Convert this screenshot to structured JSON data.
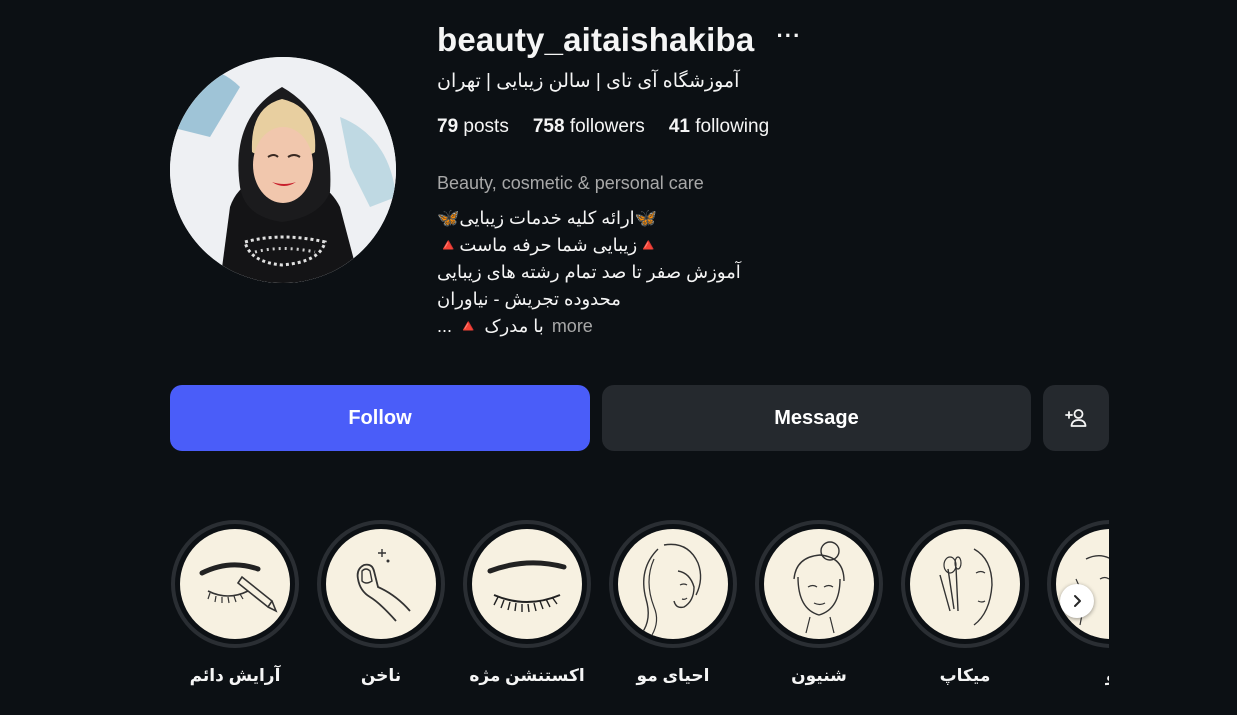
{
  "profile": {
    "username": "beauty_aitaishakiba",
    "options_label": "···",
    "full_name": "آموزشگاه آی تای | سالن زیبایی | تهران",
    "stats": {
      "posts_count": "79",
      "posts_label": "posts",
      "followers_count": "758",
      "followers_label": "followers",
      "following_count": "41",
      "following_label": "following"
    },
    "category": "Beauty, cosmetic & personal care",
    "bio": [
      "🦋ارائه کلیه خدمات زیبایی🦋",
      "🔺زیبایی شما حرفه ماست🔺",
      "آموزش صفر تا صد تمام رشته های زیبایی",
      "محدوده تجریش - نیاوران"
    ],
    "bio_last": "با مدرک 🔺 ...",
    "more_label": "more"
  },
  "actions": {
    "follow_label": "Follow",
    "message_label": "Message",
    "suggest_icon": "add-person-icon"
  },
  "highlights": [
    {
      "label": "آرایش دائم",
      "icon": "eyebrow-pencil-icon"
    },
    {
      "label": "ناخن",
      "icon": "nail-icon"
    },
    {
      "label": "اکستنشن مژه",
      "icon": "eyelash-icon"
    },
    {
      "label": "احیای مو",
      "icon": "hair-woman-icon"
    },
    {
      "label": "شنیون",
      "icon": "updo-woman-icon"
    },
    {
      "label": "میکاپ",
      "icon": "makeup-brush-icon"
    },
    {
      "label": "و",
      "icon": "face-partial-icon"
    }
  ],
  "colors": {
    "background": "#0c1014",
    "follow_button": "#4a5df9",
    "secondary_button": "#25292e",
    "muted_text": "#a8a8a8",
    "highlight_fill": "#f7f1e1"
  }
}
